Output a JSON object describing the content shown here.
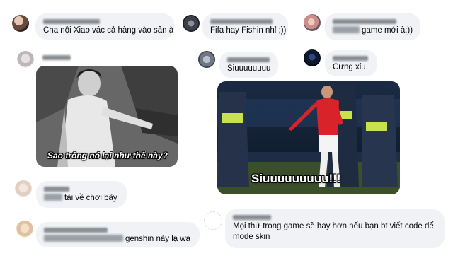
{
  "comments": [
    {
      "id": "c1",
      "text": "Cha nội Xiao vác cả hàng vào sân à"
    },
    {
      "id": "c2",
      "text": "Fifa hay Fishin nhỉ ;))"
    },
    {
      "id": "c3",
      "text": "game mới à:))"
    },
    {
      "id": "c4",
      "text": "Siuuuuuuuu"
    },
    {
      "id": "c5",
      "text": "Cưng xỉu"
    },
    {
      "id": "c6",
      "text": "tải về chơi bây"
    },
    {
      "id": "c7",
      "text": "genshin này lạ wa"
    },
    {
      "id": "c8",
      "text": "Mọi thứ trong game sẽ hay hơn nếu bạn bt viết code để mode skin"
    }
  ],
  "images": {
    "meme1_caption": "Sao trông nó lại như thế này?",
    "meme2_caption": "Siuuuuuuuuu!!!"
  },
  "colors": {
    "bubble": "#f0f2f5",
    "text": "#050505",
    "name": "#65676b"
  }
}
